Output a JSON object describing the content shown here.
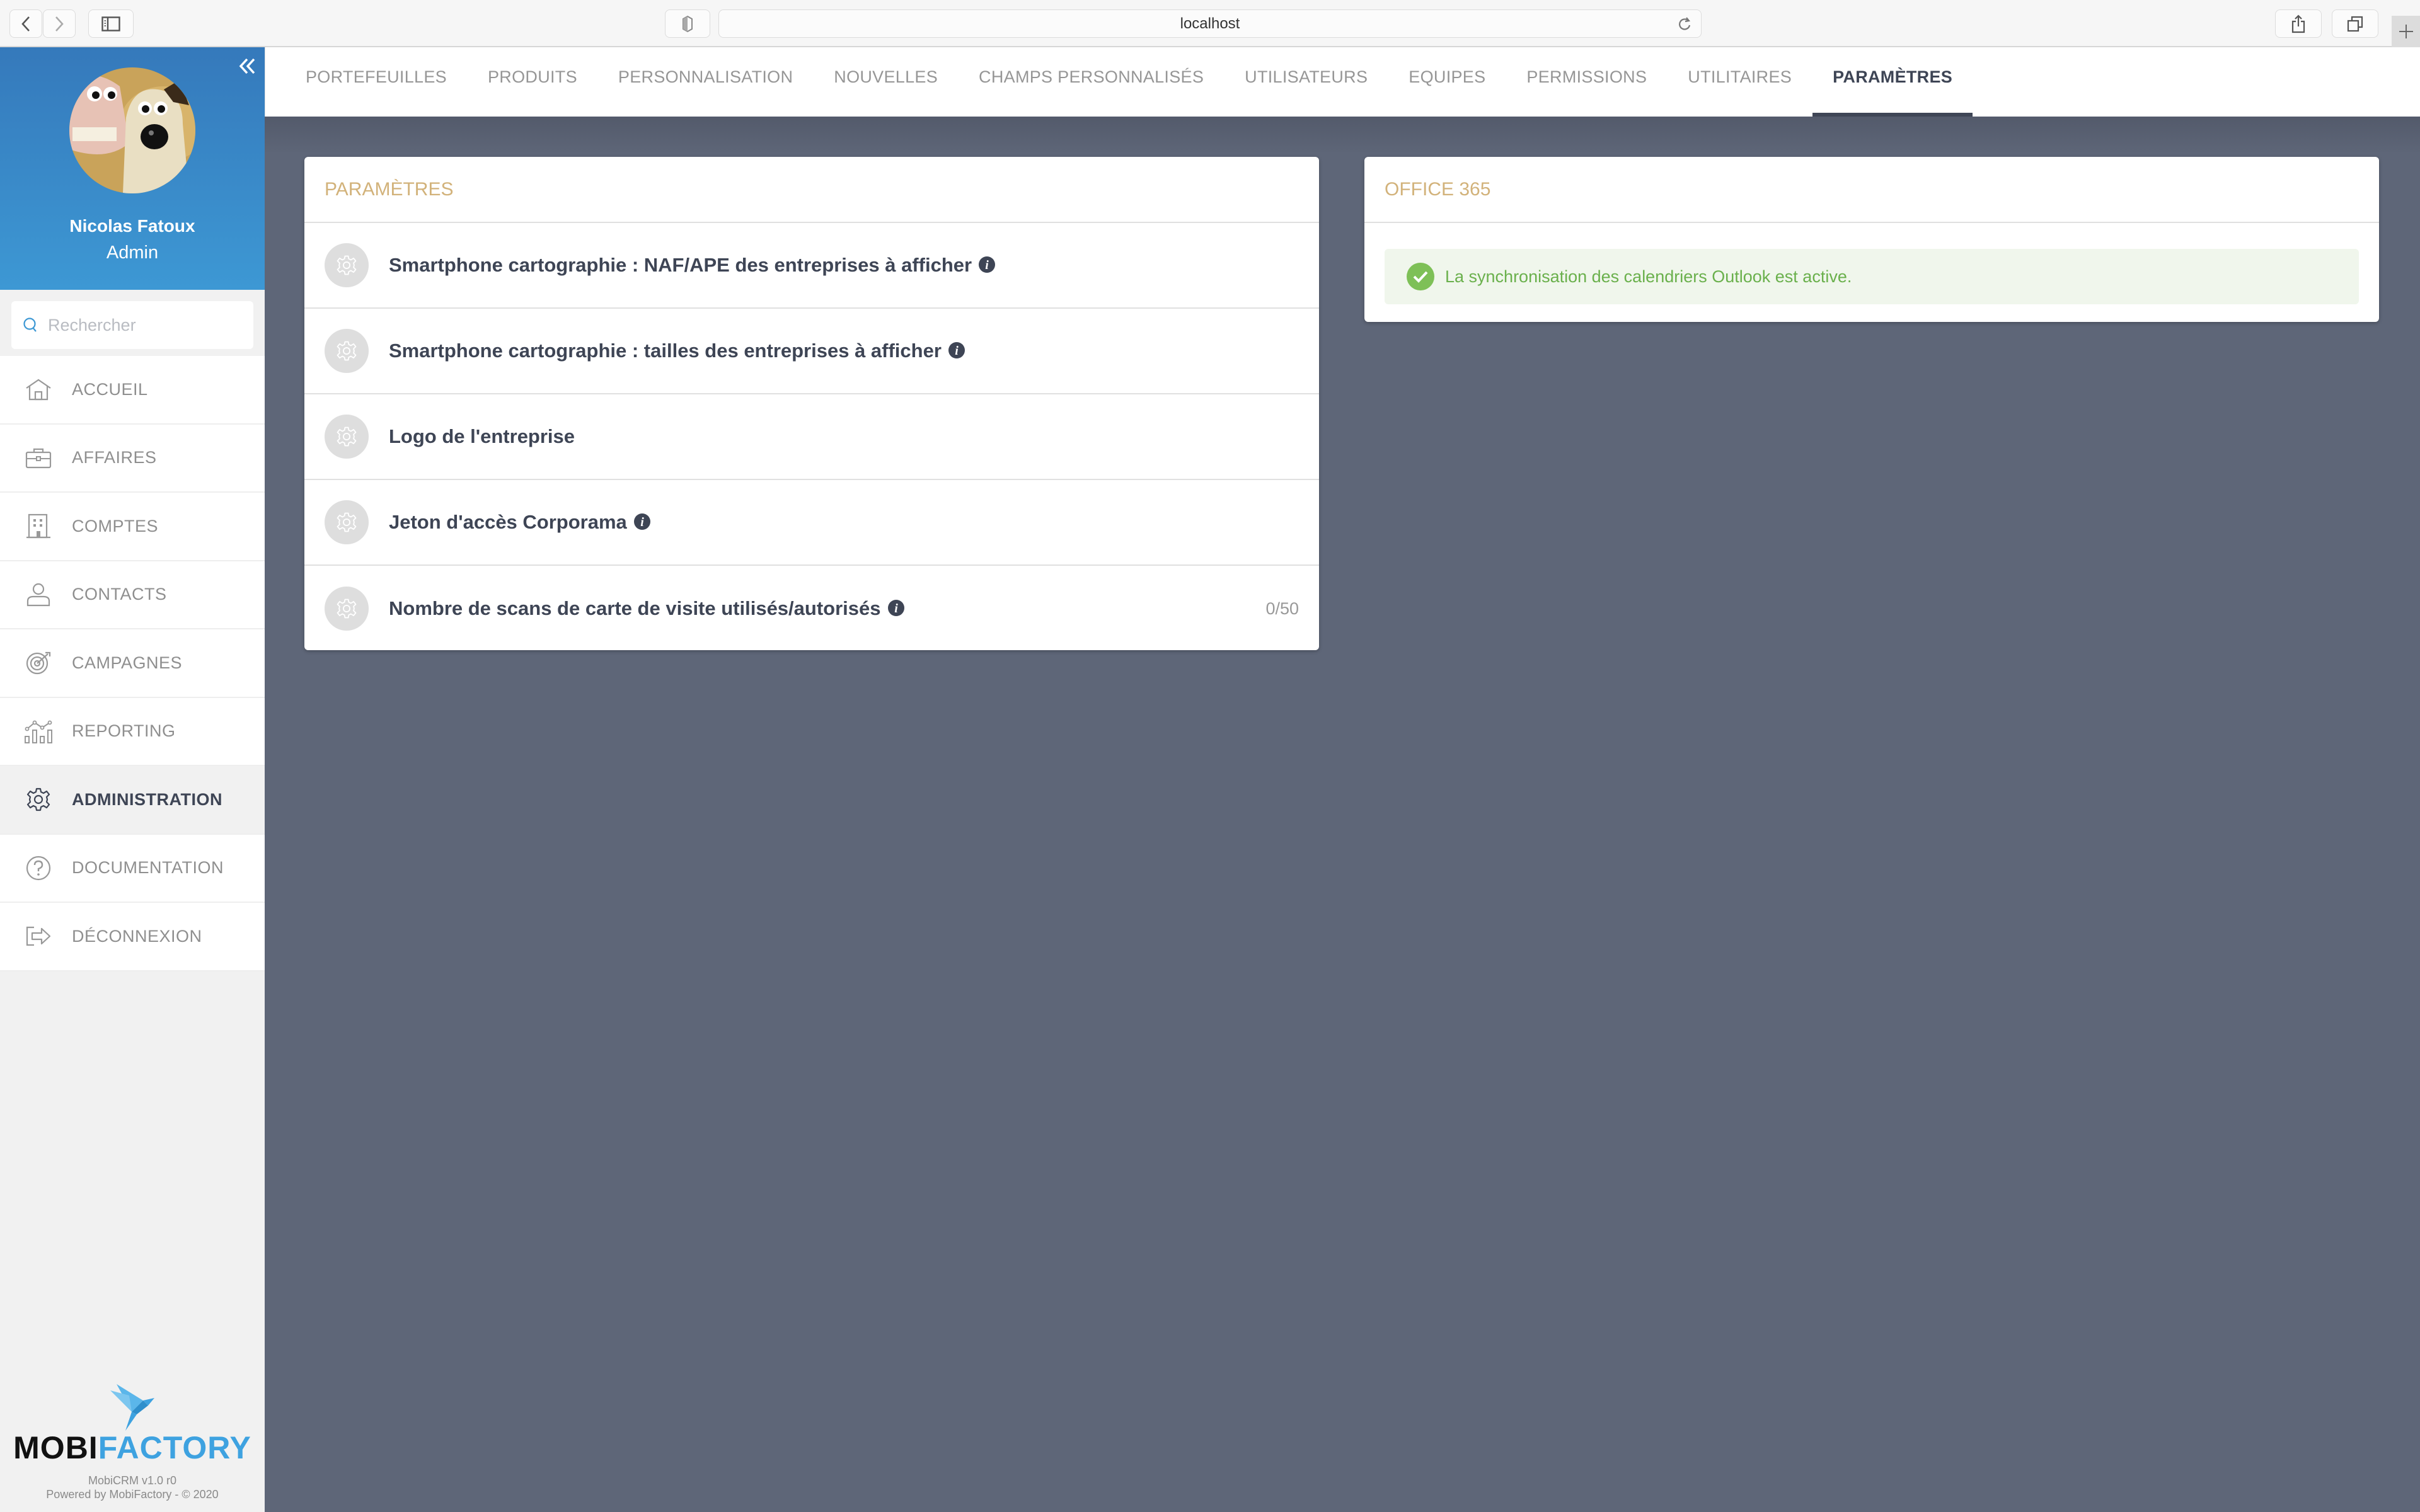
{
  "browser": {
    "url": "localhost"
  },
  "sidebar": {
    "profile": {
      "name": "Nicolas Fatoux",
      "role": "Admin"
    },
    "search": {
      "placeholder": "Rechercher",
      "value": ""
    },
    "items": [
      {
        "label": "ACCUEIL",
        "icon": "home-icon",
        "active": false
      },
      {
        "label": "AFFAIRES",
        "icon": "briefcase-icon",
        "active": false
      },
      {
        "label": "COMPTES",
        "icon": "building-icon",
        "active": false
      },
      {
        "label": "CONTACTS",
        "icon": "user-icon",
        "active": false
      },
      {
        "label": "CAMPAGNES",
        "icon": "target-icon",
        "active": false
      },
      {
        "label": "REPORTING",
        "icon": "chart-icon",
        "active": false
      },
      {
        "label": "ADMINISTRATION",
        "icon": "gear-icon",
        "active": true
      },
      {
        "label": "DOCUMENTATION",
        "icon": "help-icon",
        "active": false
      },
      {
        "label": "DÉCONNEXION",
        "icon": "logout-icon",
        "active": false
      }
    ],
    "brand": {
      "word_dark": "MOBI",
      "word_light": "FACTORY",
      "version": "MobiCRM v1.0 r0",
      "powered": "Powered by MobiFactory - © 2020"
    }
  },
  "tabs": [
    {
      "label": "PORTEFEUILLES",
      "active": false
    },
    {
      "label": "PRODUITS",
      "active": false
    },
    {
      "label": "PERSONNALISATION",
      "active": false
    },
    {
      "label": "NOUVELLES",
      "active": false
    },
    {
      "label": "CHAMPS PERSONNALISÉS",
      "active": false
    },
    {
      "label": "UTILISATEURS",
      "active": false
    },
    {
      "label": "EQUIPES",
      "active": false
    },
    {
      "label": "PERMISSIONS",
      "active": false
    },
    {
      "label": "UTILITAIRES",
      "active": false
    },
    {
      "label": "PARAMÈTRES",
      "active": true
    }
  ],
  "parametres": {
    "title": "PARAMÈTRES",
    "rows": [
      {
        "label": "Smartphone cartographie : NAF/APE des entreprises à afficher",
        "info": true,
        "value": ""
      },
      {
        "label": "Smartphone cartographie : tailles des entreprises à afficher",
        "info": true,
        "value": ""
      },
      {
        "label": "Logo de l'entreprise",
        "info": false,
        "value": ""
      },
      {
        "label": "Jeton d'accès Corporama",
        "info": true,
        "value": ""
      },
      {
        "label": "Nombre de scans de carte de visite utilisés/autorisés",
        "info": true,
        "value": "0/50"
      }
    ]
  },
  "office365": {
    "title": "OFFICE 365",
    "status_message": "La synchronisation des calendriers Outlook est active."
  },
  "colors": {
    "sidebar_gradient_top": "#3579bb",
    "sidebar_gradient_bottom": "#3d98d4",
    "card_title": "#d2b27a",
    "text_dark": "#3e4555",
    "success": "#6ab04c",
    "main_background": "#5e6678"
  }
}
